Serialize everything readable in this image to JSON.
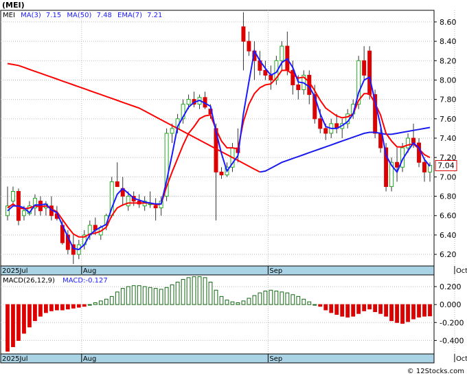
{
  "ticker_label": "(MEI)",
  "legend": {
    "symbol": "MEI",
    "ma3_label": "MA(3)",
    "ma3_value": "7.15",
    "ma50_label": "MA(50)",
    "ma50_value": "7.48",
    "ema7_label": "EMA(7)",
    "ema7_value": "7.21"
  },
  "last_price_label": "7.04",
  "macd_legend": {
    "label": "MACD(26,12,9)",
    "value_label": "MACD:-0.127"
  },
  "watermark": "© 12Stocks.com",
  "colors": {
    "up": "#22aa22",
    "down": "#dd0000",
    "ma3": "#1a1aff",
    "ema7": "#ff0000",
    "ma50_line": "#1a1aee",
    "band": "#aad4e6",
    "macd_pos": "#116611",
    "macd_neg": "#dd0000"
  },
  "chart_data": [
    {
      "type": "candlestick",
      "x_labels": [
        "2025Jul",
        "Aug",
        "Sep",
        "Oct"
      ],
      "x_label_index": [
        0,
        14,
        48,
        82
      ],
      "y_ticks": [
        6.2,
        6.4,
        6.6,
        6.8,
        7.0,
        7.2,
        7.4,
        7.6,
        7.8,
        8.0,
        8.2,
        8.4,
        8.6
      ],
      "ylim": [
        6.08,
        8.72
      ],
      "grid": true,
      "ohlc": [
        [
          6.6,
          6.9,
          6.55,
          6.7
        ],
        [
          6.75,
          6.9,
          6.7,
          6.85
        ],
        [
          6.85,
          6.88,
          6.5,
          6.55
        ],
        [
          6.6,
          6.7,
          6.55,
          6.65
        ],
        [
          6.62,
          6.75,
          6.6,
          6.7
        ],
        [
          6.68,
          6.82,
          6.6,
          6.78
        ],
        [
          6.75,
          6.8,
          6.6,
          6.65
        ],
        [
          6.68,
          6.75,
          6.6,
          6.72
        ],
        [
          6.7,
          6.8,
          6.55,
          6.6
        ],
        [
          6.62,
          6.7,
          6.55,
          6.57
        ],
        [
          6.5,
          6.55,
          6.3,
          6.32
        ],
        [
          6.4,
          6.45,
          6.2,
          6.25
        ],
        [
          6.3,
          6.4,
          6.1,
          6.2
        ],
        [
          6.2,
          6.35,
          6.15,
          6.3
        ],
        [
          6.3,
          6.45,
          6.25,
          6.4
        ],
        [
          6.4,
          6.55,
          6.35,
          6.5
        ],
        [
          6.5,
          6.58,
          6.4,
          6.45
        ],
        [
          6.4,
          6.5,
          6.35,
          6.48
        ],
        [
          6.5,
          6.62,
          6.45,
          6.6
        ],
        [
          6.6,
          7.0,
          6.58,
          6.95
        ],
        [
          6.95,
          7.15,
          6.9,
          6.9
        ],
        [
          6.88,
          7.0,
          6.7,
          6.8
        ],
        [
          6.7,
          6.85,
          6.65,
          6.8
        ],
        [
          6.8,
          6.85,
          6.7,
          6.75
        ],
        [
          6.75,
          6.82,
          6.68,
          6.72
        ],
        [
          6.7,
          6.8,
          6.65,
          6.75
        ],
        [
          6.72,
          6.85,
          6.68,
          6.72
        ],
        [
          6.7,
          6.78,
          6.55,
          6.68
        ],
        [
          6.68,
          6.8,
          6.6,
          6.75
        ],
        [
          6.8,
          7.5,
          6.75,
          7.45
        ],
        [
          7.45,
          7.55,
          7.35,
          7.5
        ],
        [
          7.5,
          7.65,
          7.45,
          7.6
        ],
        [
          7.6,
          7.8,
          7.55,
          7.75
        ],
        [
          7.75,
          7.85,
          7.7,
          7.8
        ],
        [
          7.8,
          7.88,
          7.72,
          7.75
        ],
        [
          7.75,
          7.85,
          7.7,
          7.82
        ],
        [
          7.82,
          7.88,
          7.7,
          7.72
        ],
        [
          7.7,
          7.75,
          7.6,
          7.65
        ],
        [
          7.5,
          7.55,
          6.55,
          7.05
        ],
        [
          7.05,
          7.1,
          6.98,
          7.02
        ],
        [
          7.02,
          7.15,
          7.0,
          7.1
        ],
        [
          7.1,
          7.35,
          7.05,
          7.3
        ],
        [
          7.3,
          7.5,
          7.15,
          7.25
        ],
        [
          8.55,
          8.7,
          8.1,
          8.4
        ],
        [
          8.4,
          8.5,
          8.25,
          8.3
        ],
        [
          8.3,
          8.4,
          8.0,
          8.2
        ],
        [
          8.2,
          8.3,
          8.05,
          8.1
        ],
        [
          8.1,
          8.2,
          8.0,
          8.05
        ],
        [
          8.05,
          8.15,
          7.9,
          8.0
        ],
        [
          8.0,
          8.25,
          7.95,
          8.2
        ],
        [
          8.2,
          8.4,
          8.1,
          8.35
        ],
        [
          8.35,
          8.5,
          8.05,
          8.1
        ],
        [
          8.1,
          8.2,
          7.85,
          7.95
        ],
        [
          7.95,
          8.05,
          7.8,
          7.9
        ],
        [
          7.9,
          8.1,
          7.85,
          8.05
        ],
        [
          8.05,
          8.1,
          7.75,
          7.85
        ],
        [
          7.85,
          7.95,
          7.55,
          7.6
        ],
        [
          7.6,
          7.7,
          7.45,
          7.5
        ],
        [
          7.5,
          7.55,
          7.38,
          7.45
        ],
        [
          7.45,
          7.6,
          7.4,
          7.55
        ],
        [
          7.55,
          7.65,
          7.45,
          7.5
        ],
        [
          7.5,
          7.6,
          7.4,
          7.55
        ],
        [
          7.55,
          7.7,
          7.5,
          7.65
        ],
        [
          7.65,
          7.8,
          7.6,
          7.75
        ],
        [
          7.75,
          8.25,
          7.7,
          8.2
        ],
        [
          8.2,
          8.35,
          8.0,
          8.05
        ],
        [
          8.3,
          8.35,
          7.8,
          7.85
        ],
        [
          7.85,
          7.9,
          7.4,
          7.45
        ],
        [
          7.45,
          7.5,
          7.25,
          7.3
        ],
        [
          7.3,
          7.35,
          6.85,
          6.9
        ],
        [
          6.9,
          7.2,
          6.85,
          7.15
        ],
        [
          7.15,
          7.3,
          6.95,
          7.1
        ],
        [
          7.1,
          7.35,
          7.05,
          7.3
        ],
        [
          7.3,
          7.45,
          7.25,
          7.4
        ],
        [
          7.4,
          7.55,
          7.3,
          7.35
        ],
        [
          7.35,
          7.4,
          7.1,
          7.15
        ],
        [
          7.15,
          7.2,
          6.95,
          7.05
        ],
        [
          7.05,
          7.15,
          6.95,
          7.12
        ]
      ],
      "series": [
        {
          "name": "MA(3)",
          "values": [
            6.65,
            6.7,
            6.7,
            6.68,
            6.63,
            6.71,
            6.71,
            6.72,
            6.66,
            6.63,
            6.5,
            6.38,
            6.26,
            6.25,
            6.3,
            6.4,
            6.45,
            6.48,
            6.51,
            6.68,
            6.82,
            6.88,
            6.83,
            6.78,
            6.76,
            6.74,
            6.73,
            6.72,
            6.72,
            6.96,
            7.23,
            7.52,
            7.62,
            7.72,
            7.77,
            7.79,
            7.76,
            7.73,
            7.47,
            7.24,
            7.06,
            7.14,
            7.22,
            7.65,
            7.98,
            8.3,
            8.2,
            8.12,
            8.05,
            8.08,
            8.18,
            8.22,
            8.13,
            7.98,
            7.97,
            7.93,
            7.83,
            7.65,
            7.52,
            7.5,
            7.5,
            7.53,
            7.57,
            7.65,
            7.87,
            8.0,
            8.03,
            7.78,
            7.53,
            7.22,
            7.12,
            7.05,
            7.18,
            7.27,
            7.35,
            7.3,
            7.18,
            7.11
          ]
        },
        {
          "name": "EMA(7)",
          "values": [
            6.68,
            6.72,
            6.68,
            6.67,
            6.68,
            6.7,
            6.69,
            6.7,
            6.67,
            6.64,
            6.56,
            6.48,
            6.41,
            6.38,
            6.38,
            6.41,
            6.42,
            6.44,
            6.48,
            6.6,
            6.68,
            6.71,
            6.73,
            6.73,
            6.73,
            6.73,
            6.73,
            6.71,
            6.72,
            6.9,
            7.05,
            7.19,
            7.33,
            7.45,
            7.52,
            7.6,
            7.63,
            7.64,
            7.49,
            7.37,
            7.3,
            7.3,
            7.29,
            7.57,
            7.75,
            7.86,
            7.92,
            7.95,
            7.96,
            8.02,
            8.1,
            8.1,
            8.06,
            8.02,
            8.03,
            7.98,
            7.89,
            7.79,
            7.71,
            7.67,
            7.63,
            7.61,
            7.62,
            7.65,
            7.79,
            7.86,
            7.86,
            7.76,
            7.64,
            7.45,
            7.37,
            7.31,
            7.31,
            7.33,
            7.34,
            7.29,
            7.23,
            7.2
          ]
        },
        {
          "name": "MA(50)",
          "values": [
            8.17,
            8.16,
            8.15,
            8.13,
            8.11,
            8.09,
            8.07,
            8.05,
            8.03,
            8.01,
            7.99,
            7.97,
            7.95,
            7.93,
            7.91,
            7.89,
            7.87,
            7.85,
            7.83,
            7.81,
            7.79,
            7.77,
            7.75,
            7.73,
            7.71,
            7.68,
            7.65,
            7.62,
            7.59,
            7.56,
            7.53,
            7.5,
            7.47,
            7.44,
            7.41,
            7.38,
            7.35,
            7.32,
            7.29,
            7.26,
            7.23,
            7.2,
            7.17,
            7.14,
            7.11,
            7.08,
            7.05,
            7.06,
            7.09,
            7.12,
            7.15,
            7.17,
            7.19,
            7.21,
            7.23,
            7.25,
            7.27,
            7.29,
            7.31,
            7.33,
            7.35,
            7.37,
            7.39,
            7.41,
            7.43,
            7.45,
            7.46,
            7.46,
            7.45,
            7.44,
            7.44,
            7.45,
            7.46,
            7.47,
            7.48,
            7.49,
            7.5,
            7.51
          ]
        }
      ]
    },
    {
      "type": "bar",
      "title": "MACD(26,12,9)",
      "y_ticks": [
        -0.4,
        -0.2,
        0.0,
        0.2
      ],
      "ylim": [
        -0.55,
        0.33
      ],
      "values": [
        -0.52,
        -0.47,
        -0.4,
        -0.32,
        -0.25,
        -0.18,
        -0.13,
        -0.09,
        -0.07,
        -0.06,
        -0.06,
        -0.05,
        -0.04,
        -0.03,
        -0.02,
        0.0,
        0.02,
        0.04,
        0.06,
        0.09,
        0.14,
        0.18,
        0.2,
        0.21,
        0.21,
        0.2,
        0.19,
        0.18,
        0.17,
        0.19,
        0.22,
        0.25,
        0.28,
        0.3,
        0.31,
        0.31,
        0.3,
        0.25,
        0.16,
        0.09,
        0.05,
        0.03,
        0.02,
        0.04,
        0.07,
        0.1,
        0.13,
        0.15,
        0.16,
        0.15,
        0.14,
        0.13,
        0.11,
        0.09,
        0.06,
        0.03,
        0.0,
        -0.02,
        -0.06,
        -0.09,
        -0.11,
        -0.13,
        -0.14,
        -0.13,
        -0.1,
        -0.07,
        -0.05,
        -0.08,
        -0.1,
        -0.13,
        -0.18,
        -0.2,
        -0.21,
        -0.19,
        -0.16,
        -0.14,
        -0.13,
        -0.127
      ]
    }
  ]
}
